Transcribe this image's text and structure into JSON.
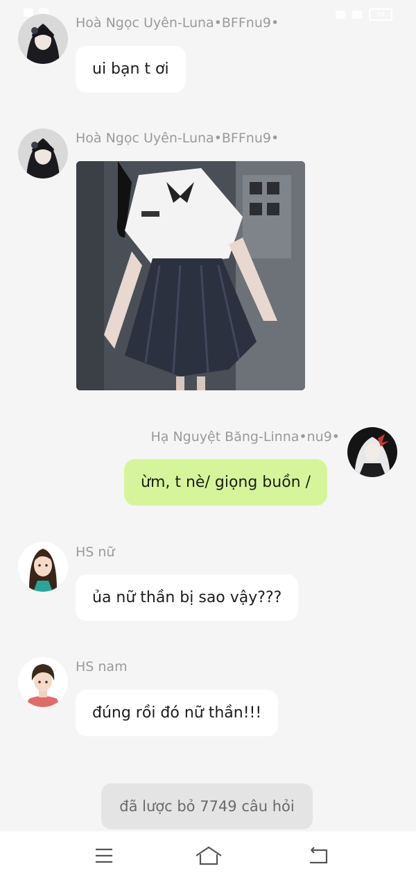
{
  "status_bar": {
    "battery": "88"
  },
  "messages": [
    {
      "sender": "Hoà Ngọc Uyên-Luna•BFFnu9•",
      "text": "ui bạn t ơi"
    },
    {
      "sender": "Hoà Ngọc Uyên-Luna•BFFnu9•",
      "image": "school-uniform-photo"
    },
    {
      "sender": "Hạ Nguyệt Băng-Linna•nu9•",
      "text": "ừm, t nè/ giọng buồn /"
    },
    {
      "sender": "HS nữ",
      "text": "ủa nữ thần bị sao vậy???"
    },
    {
      "sender": "HS nam",
      "text": "đúng rồi đó nữ thần!!!"
    }
  ],
  "system_notice": "đã lược bỏ 7749 câu hỏi",
  "nav": {
    "icons": [
      "menu-icon",
      "home-icon",
      "back-icon"
    ]
  },
  "colors": {
    "background": "#f5f5f5",
    "bubble_other": "#ffffff",
    "bubble_mine": "#d6f59a",
    "sender_text": "#9a9a9a"
  }
}
